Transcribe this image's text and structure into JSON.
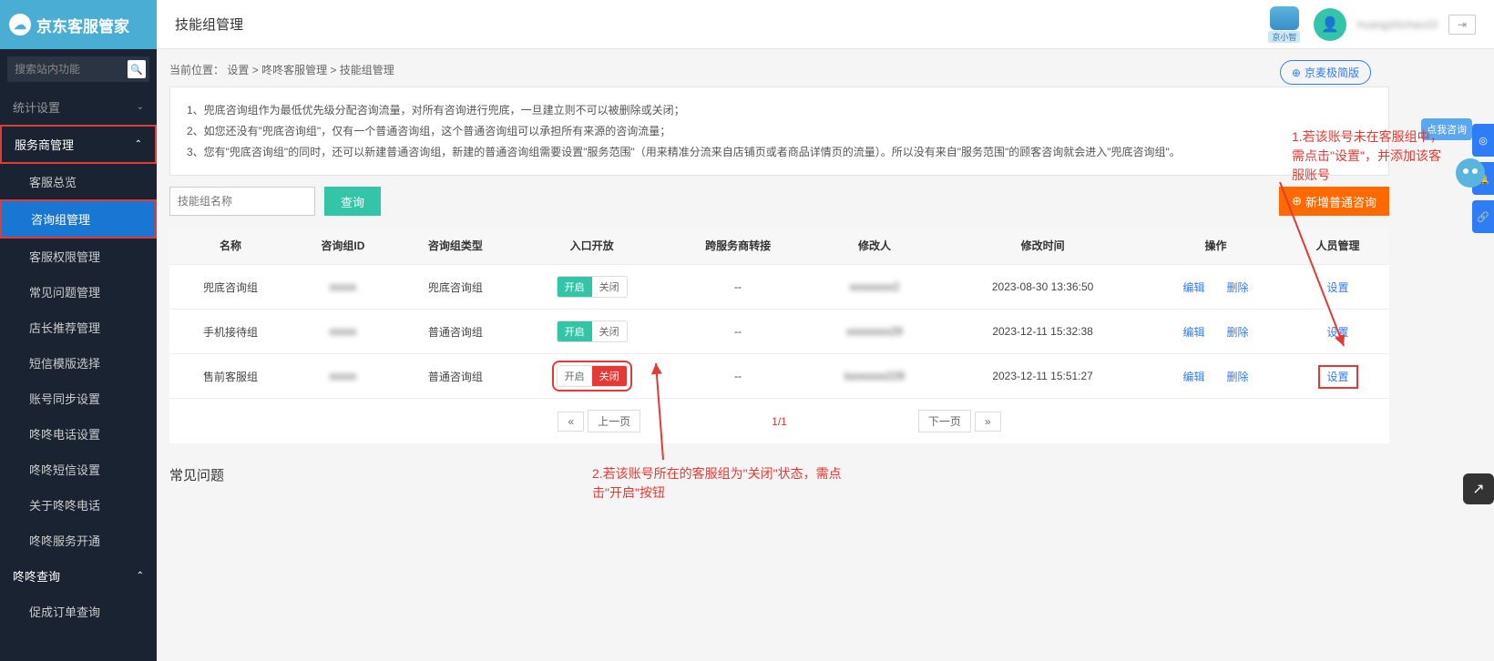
{
  "logo": "京东客服管家",
  "search_placeholder": "搜索站内功能",
  "sidebar": {
    "sections": [
      {
        "label": "统计设置",
        "expanded": false
      },
      {
        "label": "服务商管理",
        "expanded": true,
        "highlight": true
      },
      {
        "label": "咚咚查询",
        "expanded": true
      }
    ],
    "items_section1": [
      {
        "label": "客服总览"
      },
      {
        "label": "咨询组管理",
        "active": true,
        "highlight": true
      },
      {
        "label": "客服权限管理"
      },
      {
        "label": "常见问题管理"
      },
      {
        "label": "店长推荐管理"
      },
      {
        "label": "短信模版选择"
      },
      {
        "label": "账号同步设置"
      },
      {
        "label": "咚咚电话设置"
      },
      {
        "label": "咚咚短信设置"
      },
      {
        "label": "关于咚咚电话"
      },
      {
        "label": "咚咚服务开通"
      }
    ],
    "items_section2": [
      {
        "label": "促成订单查询"
      }
    ]
  },
  "header": {
    "title": "技能组管理",
    "robot_label": "京小智",
    "user": "huangzhichao10",
    "simple_btn": "京麦极简版"
  },
  "breadcrumb": {
    "prefix": "当前位置：",
    "items": [
      "设置",
      "咚咚客服管理",
      "技能组管理"
    ]
  },
  "info_lines": [
    "1、兜底咨询组作为最低优先级分配咨询流量，对所有咨询进行兜底，一旦建立则不可以被删除或关闭；",
    "2、如您还没有\"兜底咨询组\"，仅有一个普通咨询组，这个普通咨询组可以承担所有来源的咨询流量；",
    "3、您有\"兜底咨询组\"的同时，还可以新建普通咨询组，新建的普通咨询组需要设置\"服务范围\"（用来精准分流来自店铺页或者商品详情页的流量）。所以没有来自\"服务范围\"的顾客咨询就会进入\"兜底咨询组\"。"
  ],
  "toolbar": {
    "placeholder": "技能组名称",
    "search": "查询",
    "add": "新增普通咨询"
  },
  "table": {
    "headers": [
      "名称",
      "咨询组ID",
      "咨询组类型",
      "入口开放",
      "跨服务商转接",
      "修改人",
      "修改时间",
      "操作",
      "人员管理"
    ],
    "toggle_on": "开启",
    "toggle_off": "关闭",
    "action_edit": "编辑",
    "action_delete": "删除",
    "action_set": "设置",
    "rows": [
      {
        "name": "兜底咨询组",
        "id": "xxxxx",
        "type": "兜底咨询组",
        "open": true,
        "cross": "--",
        "user": "xxxxxxxx2",
        "time": "2023-08-30 13:36:50"
      },
      {
        "name": "手机接待组",
        "id": "xxxxx",
        "type": "普通咨询组",
        "open": true,
        "cross": "--",
        "user": "xxxxxxxx29",
        "time": "2023-12-11 15:32:38"
      },
      {
        "name": "售前客服组",
        "id": "xxxxx",
        "type": "普通咨询组",
        "open": false,
        "cross": "--",
        "user": "luoxxxxx229",
        "time": "2023-12-11 15:51:27",
        "highlight": true
      }
    ]
  },
  "pagination": {
    "prev": "上一页",
    "next": "下一页",
    "info": "1/1"
  },
  "faq_title": "常见问题",
  "annotations": {
    "a1": "1.若该账号未在客服组中，需点击\"设置\"，并添加该客服账号",
    "a2": "2.若该账号所在的客服组为\"关闭\"状态，需点击\"开启\"按钮"
  },
  "rside_tag": "点我咨询"
}
